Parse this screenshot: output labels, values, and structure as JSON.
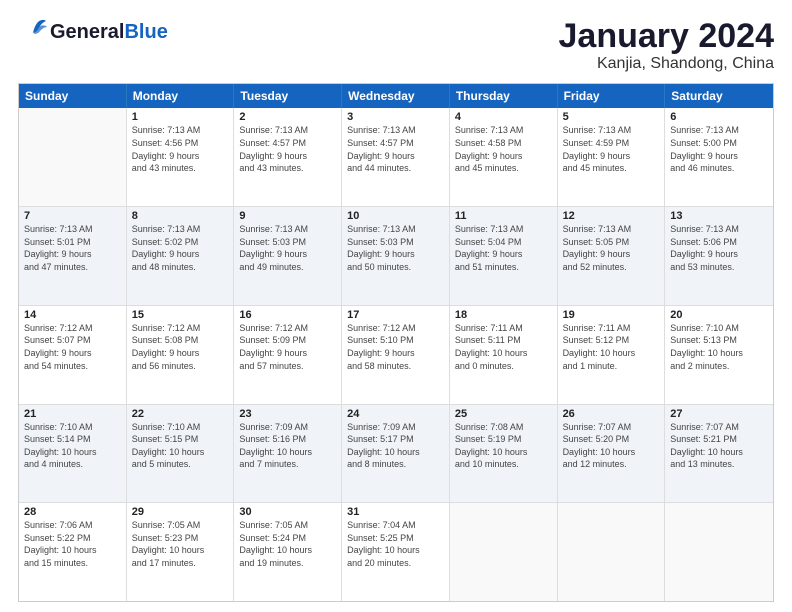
{
  "header": {
    "logo_general": "General",
    "logo_blue": "Blue",
    "title": "January 2024",
    "subtitle": "Kanjia, Shandong, China"
  },
  "days": [
    "Sunday",
    "Monday",
    "Tuesday",
    "Wednesday",
    "Thursday",
    "Friday",
    "Saturday"
  ],
  "rows": [
    [
      {
        "day": "",
        "text": ""
      },
      {
        "day": "1",
        "text": "Sunrise: 7:13 AM\nSunset: 4:56 PM\nDaylight: 9 hours\nand 43 minutes."
      },
      {
        "day": "2",
        "text": "Sunrise: 7:13 AM\nSunset: 4:57 PM\nDaylight: 9 hours\nand 43 minutes."
      },
      {
        "day": "3",
        "text": "Sunrise: 7:13 AM\nSunset: 4:57 PM\nDaylight: 9 hours\nand 44 minutes."
      },
      {
        "day": "4",
        "text": "Sunrise: 7:13 AM\nSunset: 4:58 PM\nDaylight: 9 hours\nand 45 minutes."
      },
      {
        "day": "5",
        "text": "Sunrise: 7:13 AM\nSunset: 4:59 PM\nDaylight: 9 hours\nand 45 minutes."
      },
      {
        "day": "6",
        "text": "Sunrise: 7:13 AM\nSunset: 5:00 PM\nDaylight: 9 hours\nand 46 minutes."
      }
    ],
    [
      {
        "day": "7",
        "text": "Sunrise: 7:13 AM\nSunset: 5:01 PM\nDaylight: 9 hours\nand 47 minutes."
      },
      {
        "day": "8",
        "text": "Sunrise: 7:13 AM\nSunset: 5:02 PM\nDaylight: 9 hours\nand 48 minutes."
      },
      {
        "day": "9",
        "text": "Sunrise: 7:13 AM\nSunset: 5:03 PM\nDaylight: 9 hours\nand 49 minutes."
      },
      {
        "day": "10",
        "text": "Sunrise: 7:13 AM\nSunset: 5:03 PM\nDaylight: 9 hours\nand 50 minutes."
      },
      {
        "day": "11",
        "text": "Sunrise: 7:13 AM\nSunset: 5:04 PM\nDaylight: 9 hours\nand 51 minutes."
      },
      {
        "day": "12",
        "text": "Sunrise: 7:13 AM\nSunset: 5:05 PM\nDaylight: 9 hours\nand 52 minutes."
      },
      {
        "day": "13",
        "text": "Sunrise: 7:13 AM\nSunset: 5:06 PM\nDaylight: 9 hours\nand 53 minutes."
      }
    ],
    [
      {
        "day": "14",
        "text": "Sunrise: 7:12 AM\nSunset: 5:07 PM\nDaylight: 9 hours\nand 54 minutes."
      },
      {
        "day": "15",
        "text": "Sunrise: 7:12 AM\nSunset: 5:08 PM\nDaylight: 9 hours\nand 56 minutes."
      },
      {
        "day": "16",
        "text": "Sunrise: 7:12 AM\nSunset: 5:09 PM\nDaylight: 9 hours\nand 57 minutes."
      },
      {
        "day": "17",
        "text": "Sunrise: 7:12 AM\nSunset: 5:10 PM\nDaylight: 9 hours\nand 58 minutes."
      },
      {
        "day": "18",
        "text": "Sunrise: 7:11 AM\nSunset: 5:11 PM\nDaylight: 10 hours\nand 0 minutes."
      },
      {
        "day": "19",
        "text": "Sunrise: 7:11 AM\nSunset: 5:12 PM\nDaylight: 10 hours\nand 1 minute."
      },
      {
        "day": "20",
        "text": "Sunrise: 7:10 AM\nSunset: 5:13 PM\nDaylight: 10 hours\nand 2 minutes."
      }
    ],
    [
      {
        "day": "21",
        "text": "Sunrise: 7:10 AM\nSunset: 5:14 PM\nDaylight: 10 hours\nand 4 minutes."
      },
      {
        "day": "22",
        "text": "Sunrise: 7:10 AM\nSunset: 5:15 PM\nDaylight: 10 hours\nand 5 minutes."
      },
      {
        "day": "23",
        "text": "Sunrise: 7:09 AM\nSunset: 5:16 PM\nDaylight: 10 hours\nand 7 minutes."
      },
      {
        "day": "24",
        "text": "Sunrise: 7:09 AM\nSunset: 5:17 PM\nDaylight: 10 hours\nand 8 minutes."
      },
      {
        "day": "25",
        "text": "Sunrise: 7:08 AM\nSunset: 5:19 PM\nDaylight: 10 hours\nand 10 minutes."
      },
      {
        "day": "26",
        "text": "Sunrise: 7:07 AM\nSunset: 5:20 PM\nDaylight: 10 hours\nand 12 minutes."
      },
      {
        "day": "27",
        "text": "Sunrise: 7:07 AM\nSunset: 5:21 PM\nDaylight: 10 hours\nand 13 minutes."
      }
    ],
    [
      {
        "day": "28",
        "text": "Sunrise: 7:06 AM\nSunset: 5:22 PM\nDaylight: 10 hours\nand 15 minutes."
      },
      {
        "day": "29",
        "text": "Sunrise: 7:05 AM\nSunset: 5:23 PM\nDaylight: 10 hours\nand 17 minutes."
      },
      {
        "day": "30",
        "text": "Sunrise: 7:05 AM\nSunset: 5:24 PM\nDaylight: 10 hours\nand 19 minutes."
      },
      {
        "day": "31",
        "text": "Sunrise: 7:04 AM\nSunset: 5:25 PM\nDaylight: 10 hours\nand 20 minutes."
      },
      {
        "day": "",
        "text": ""
      },
      {
        "day": "",
        "text": ""
      },
      {
        "day": "",
        "text": ""
      }
    ]
  ]
}
